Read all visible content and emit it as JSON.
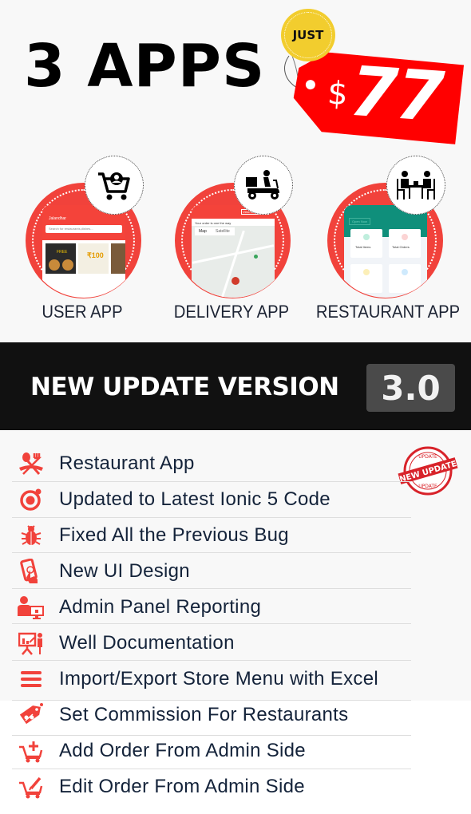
{
  "hero": {
    "headline": "3 APPS",
    "badge_text": "JUST",
    "price_currency": "$",
    "price_value": "77",
    "colors": {
      "tag_red": "#ff0000",
      "badge_yellow": "#f2cd2e",
      "circle_red": "#f1423b"
    }
  },
  "apps": [
    {
      "label": "USER APP",
      "icon": "shopping-cart-user-icon",
      "screen": {
        "location": "Jalandhar",
        "search_placeholder": "Search for restaurants,dishes...",
        "promo": "FREE",
        "offer": "₹100"
      }
    },
    {
      "label": "DELIVERY APP",
      "icon": "delivery-scooter-icon",
      "screen": {
        "status": "Your order is one the way",
        "button": "View Order Detail",
        "map_tab": "Map",
        "satellite_tab": "Satellite"
      }
    },
    {
      "label": "RESTAURANT APP",
      "icon": "restaurant-dining-icon",
      "screen": {
        "button": "Open Now",
        "card1": "Total Items",
        "card2": "Total Orders"
      }
    }
  ],
  "banner": {
    "text": "NEW UPDATE VERSION",
    "version": "3.0"
  },
  "stamp": {
    "top": "UPDATE",
    "main": "NEW UPDATE",
    "bottom": "UPDATE"
  },
  "features": [
    {
      "label": "Restaurant App",
      "icon": "restaurant-cutlery-icon"
    },
    {
      "label": "Updated to Latest Ionic 5 Code",
      "icon": "ionic-logo-icon"
    },
    {
      "label": "Fixed All the Previous Bug",
      "icon": "bug-icon"
    },
    {
      "label": "New UI Design",
      "icon": "touch-phone-icon"
    },
    {
      "label": "Admin Panel Reporting",
      "icon": "admin-monitor-icon"
    },
    {
      "label": "Well Documentation",
      "icon": "presentation-icon"
    },
    {
      "label": "Import/Export Store Menu with Excel",
      "icon": "menu-lines-icon"
    },
    {
      "label": "Set Commission For Restaurants",
      "icon": "percent-tag-icon"
    },
    {
      "label": "Add Order From Admin Side",
      "icon": "cart-add-icon"
    },
    {
      "label": "Edit Order From Admin Side",
      "icon": "cart-edit-icon"
    }
  ]
}
